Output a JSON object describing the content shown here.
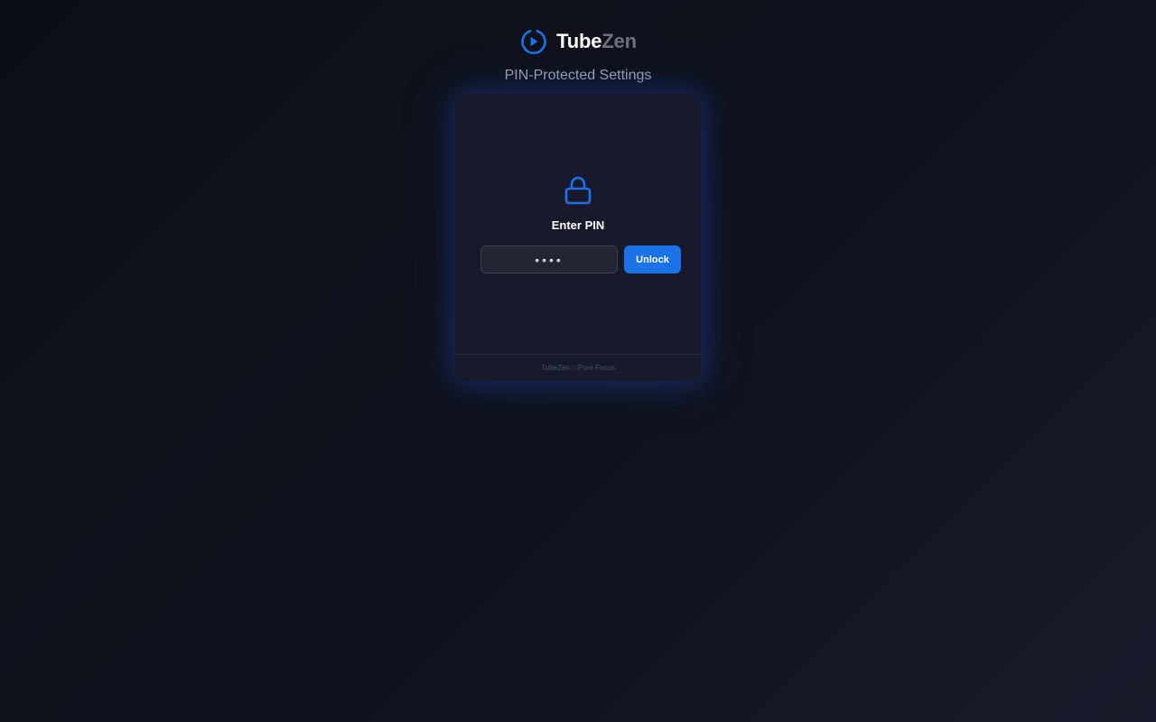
{
  "header": {
    "logo_icon": "circular-play-icon",
    "brand_primary": "Tube",
    "brand_secondary": "Zen",
    "subtitle": "PIN-Protected Settings"
  },
  "card": {
    "lock_icon": "lock-icon",
    "title": "Enter PIN",
    "pin_input": {
      "value": "",
      "placeholder": "••••"
    },
    "unlock_label": "Unlock",
    "footer": "TubeZen □ Pure Focus"
  },
  "colors": {
    "accent": "#1a73e8",
    "background": "#12131d",
    "card": "#181a2b",
    "brand_muted": "#6b7280"
  }
}
